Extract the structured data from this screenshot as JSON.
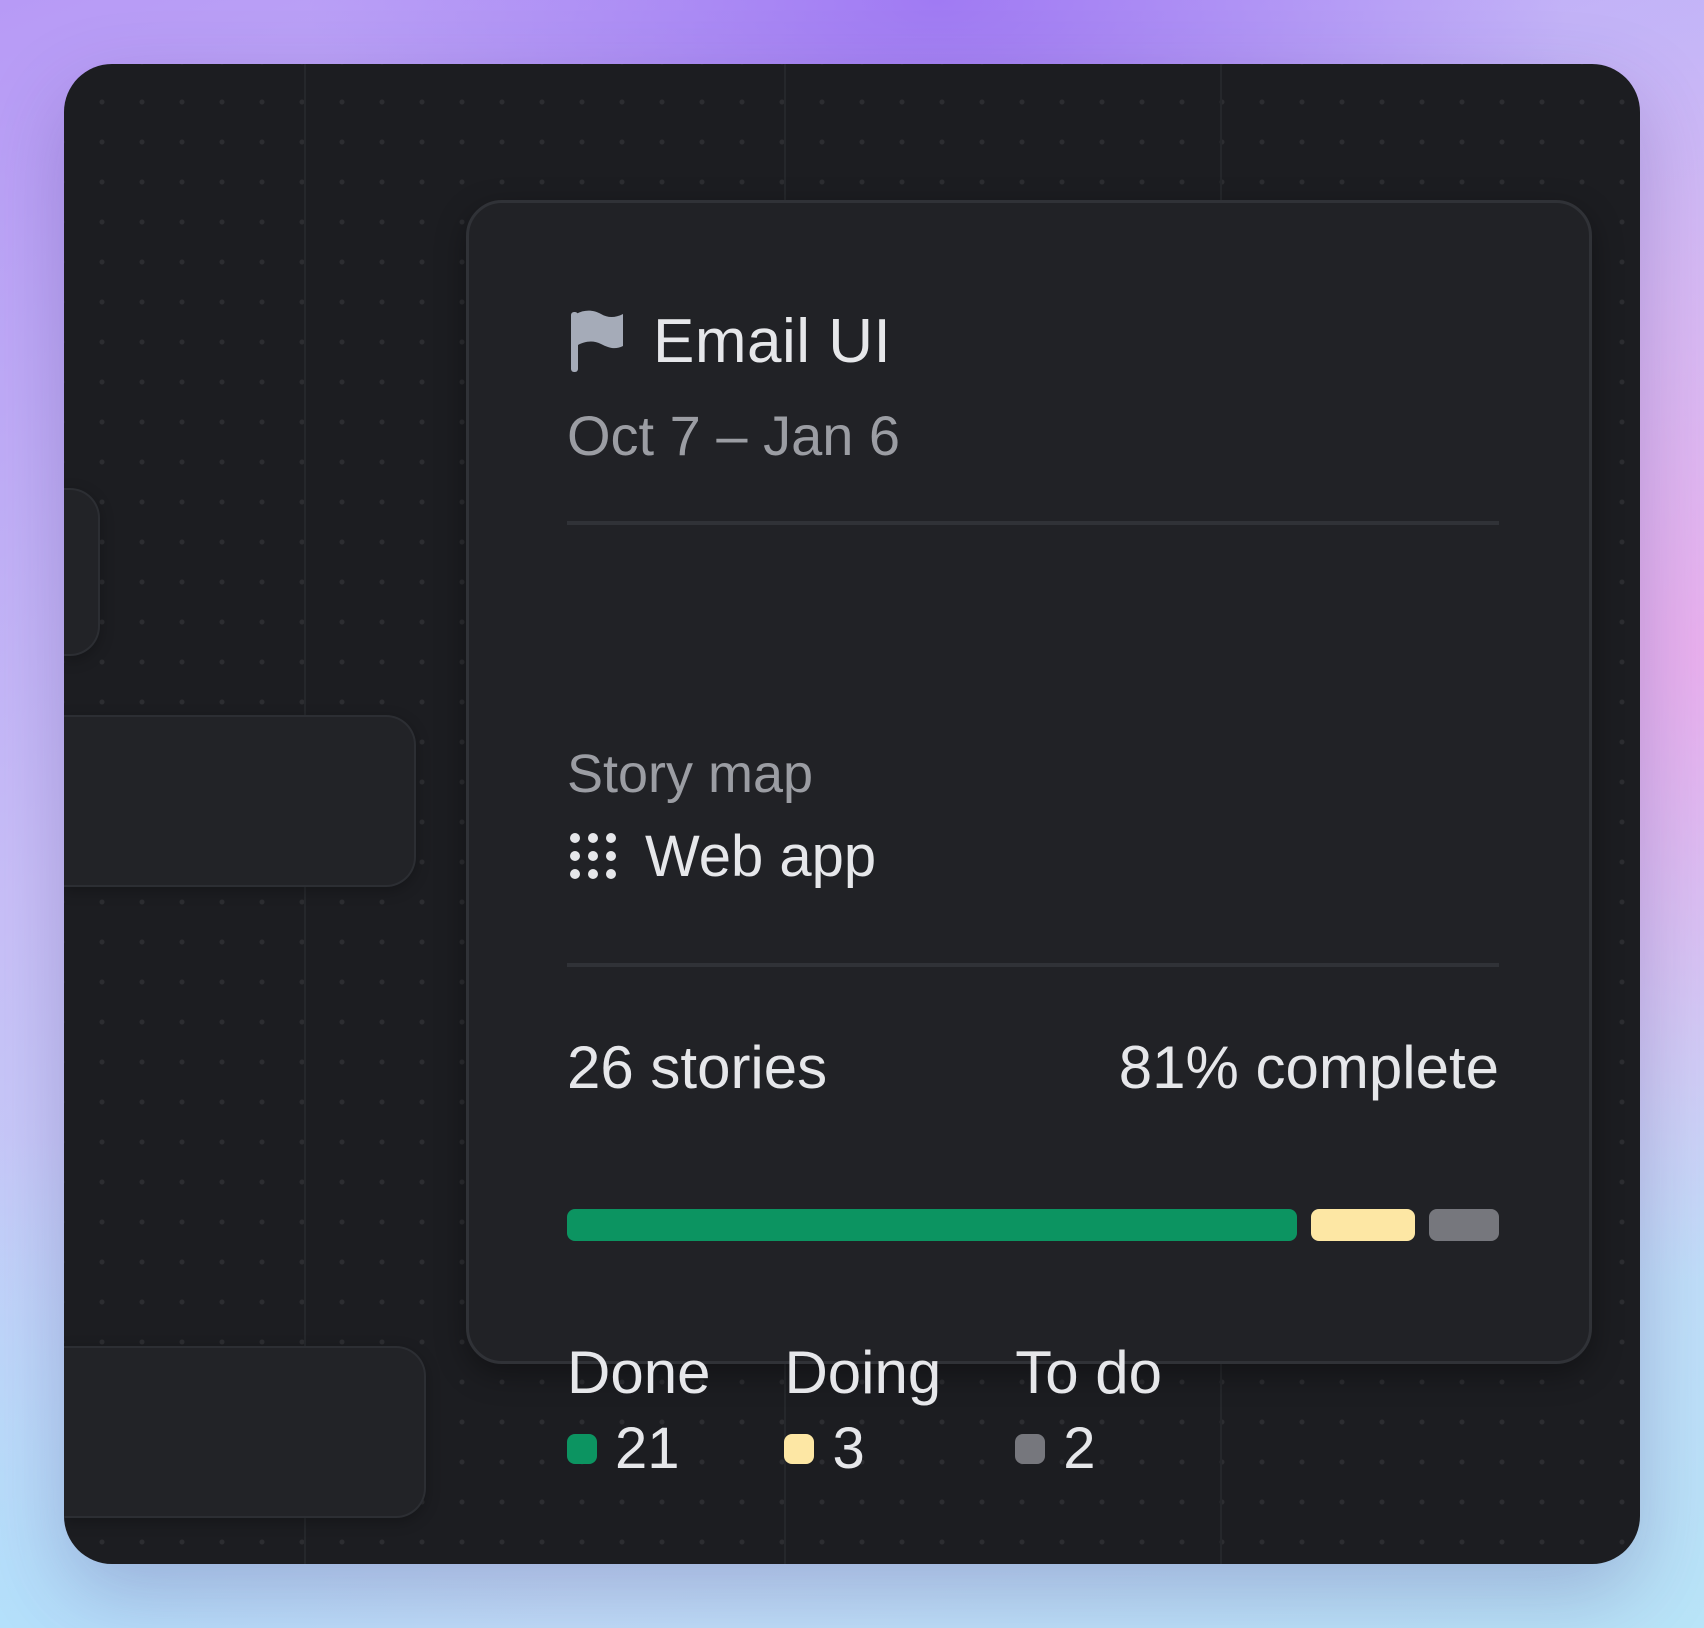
{
  "card": {
    "title": "Email UI",
    "date_range": "Oct 7 – Jan 6",
    "story_map_label": "Story map",
    "story_map_value": "Web app",
    "stories_text": "26 stories",
    "complete_text": "81% complete",
    "progress": {
      "done": 21,
      "doing": 3,
      "todo": 2
    },
    "legend": [
      {
        "label": "Done",
        "count": "21",
        "color": "#0c9461"
      },
      {
        "label": "Doing",
        "count": "3",
        "color": "#fde7a4"
      },
      {
        "label": "To do",
        "count": "2",
        "color": "#76777d"
      }
    ]
  },
  "icons": {
    "title": "flag-icon",
    "story_map": "grid-dots-icon"
  }
}
